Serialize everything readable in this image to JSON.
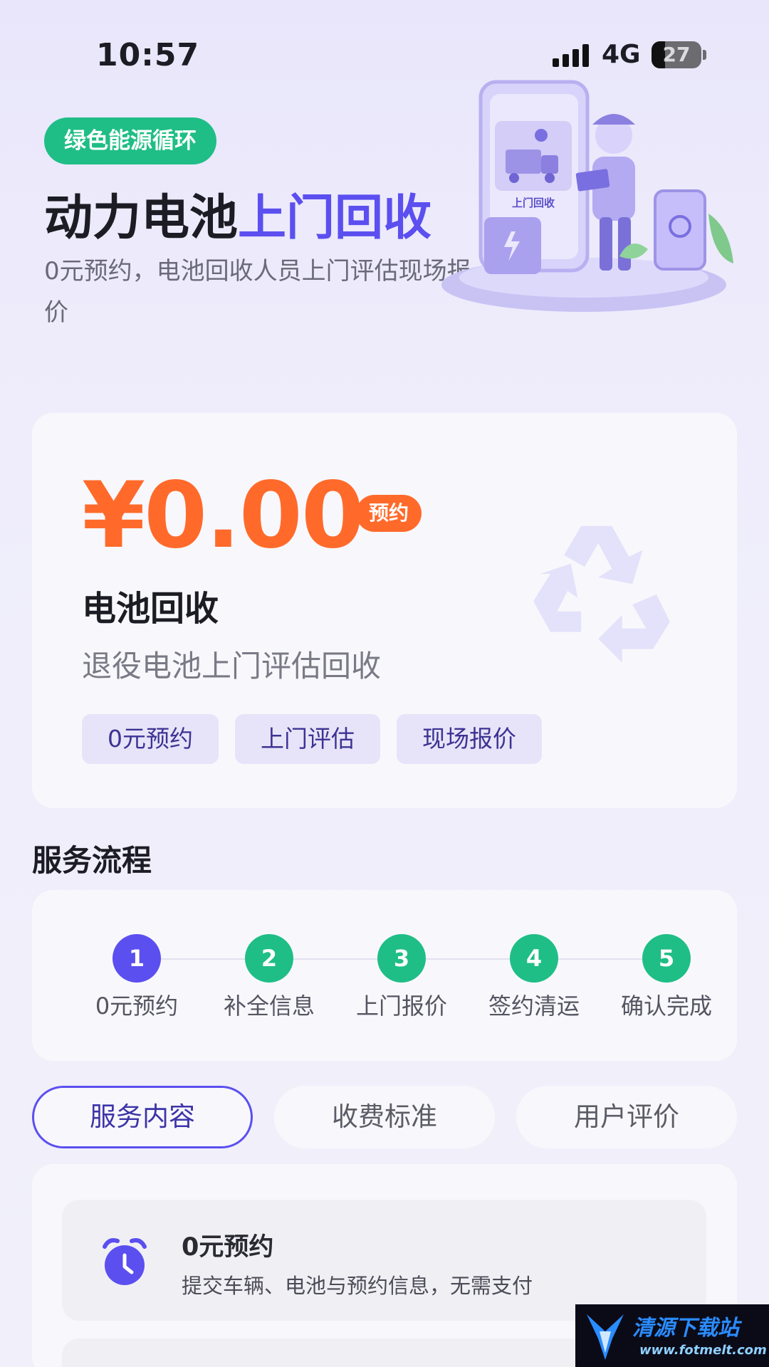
{
  "status_bar": {
    "time": "10:57",
    "network": "4G",
    "battery": "27",
    "battery_level": 0.27
  },
  "hero": {
    "badge": "绿色能源循环",
    "title_main": "动力电池",
    "title_accent": "上门回收",
    "subtitle": "0元预约，电池回收人员上门评估现场报价",
    "illustration_label": "上门回收"
  },
  "price_card": {
    "price": "¥0.00",
    "price_tag": "预约",
    "title": "电池回收",
    "description": "退役电池上门评估回收",
    "chips": [
      "0元预约",
      "上门评估",
      "现场报价"
    ]
  },
  "process": {
    "title": "服务流程",
    "steps": [
      {
        "num": "1",
        "label": "0元预约"
      },
      {
        "num": "2",
        "label": "补全信息"
      },
      {
        "num": "3",
        "label": "上门报价"
      },
      {
        "num": "4",
        "label": "签约清运"
      },
      {
        "num": "5",
        "label": "确认完成"
      }
    ]
  },
  "tabs": [
    "服务内容",
    "收费标准",
    "用户评价"
  ],
  "content": {
    "items": [
      {
        "title": "0元预约",
        "desc": "提交车辆、电池与预约信息，无需支付",
        "icon": "alarm-clock-icon"
      }
    ]
  },
  "watermark": {
    "name": "清源下载站",
    "url": "www.fotmelt.com"
  },
  "colors": {
    "accent": "#5b4ff0",
    "green": "#1fbe86",
    "orange": "#ff6a2b"
  }
}
